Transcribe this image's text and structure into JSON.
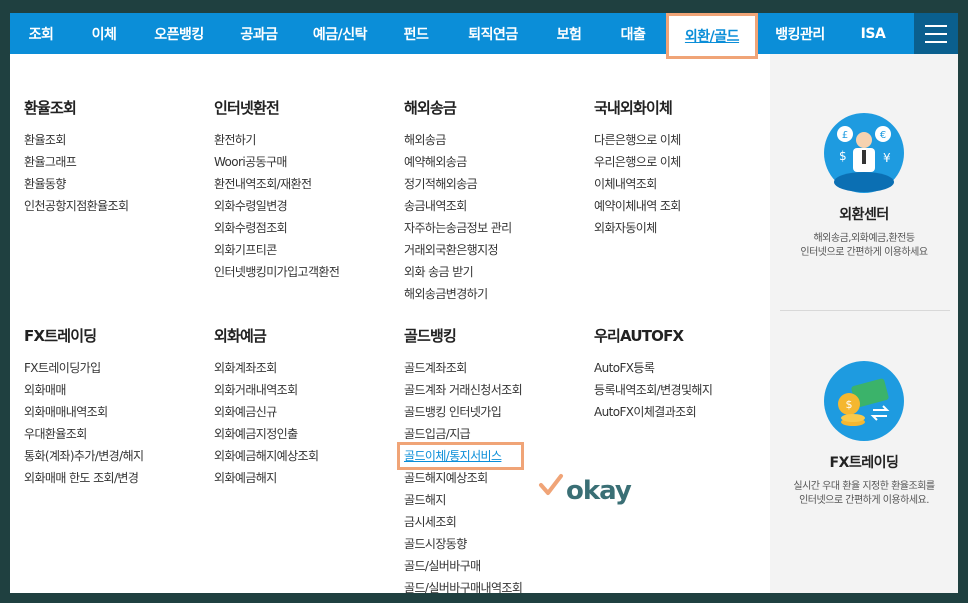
{
  "nav": {
    "items": [
      "조회",
      "이체",
      "오픈뱅킹",
      "공과금",
      "예금/신탁",
      "펀드",
      "퇴직연금",
      "보험",
      "대출",
      "외환/골드",
      "뱅킹관리",
      "ISA"
    ],
    "active": "외환/골드"
  },
  "columns": [
    {
      "sections": [
        {
          "title": "환율조회",
          "links": [
            "환율조회",
            "환율그래프",
            "환율동향",
            "인천공항지점환율조회"
          ]
        },
        {
          "title": "FX트레이딩",
          "links": [
            "FX트레이딩가입",
            "외화매매",
            "외화매매내역조회",
            "우대환율조회",
            "통화(계좌)추가/변경/해지",
            "외화매매 한도 조회/변경"
          ]
        }
      ]
    },
    {
      "sections": [
        {
          "title": "인터넷환전",
          "links": [
            "환전하기",
            "Woori공동구매",
            "환전내역조회/재환전",
            "외화수령일변경",
            "외화수령점조회",
            "외화기프티콘",
            "인터넷뱅킹미가입고객환전"
          ]
        },
        {
          "title": "외화예금",
          "links": [
            "외화계좌조회",
            "외화거래내역조회",
            "외화예금신규",
            "외화예금지정인출",
            "외화예금해지예상조회",
            "외화예금해지"
          ]
        }
      ]
    },
    {
      "sections": [
        {
          "title": "해외송금",
          "links": [
            "해외송금",
            "예약해외송금",
            "정기적해외송금",
            "송금내역조회",
            "자주하는송금정보 관리",
            "거래외국환은행지정",
            "외화 송금 받기",
            "해외송금변경하기"
          ]
        },
        {
          "title": "골드뱅킹",
          "links": [
            "골드계좌조회",
            "골드계좌 거래신청서조회",
            "골드뱅킹 인터넷가입",
            "골드입금/지급",
            "골드이체/통지서비스",
            "골드해지예상조회",
            "골드해지",
            "금시세조회",
            "골드시장동향",
            "골드/실버바구매",
            "골드/실버바구매내역조회"
          ]
        }
      ]
    },
    {
      "sections": [
        {
          "title": "국내외화이체",
          "links": [
            "다른은행으로 이체",
            "우리은행으로 이체",
            "이체내역조회",
            "예약이체내역 조회",
            "외화자동이체"
          ]
        },
        {
          "title": "우리AUTOFX",
          "links": [
            "AutoFX등록",
            "등록내역조회/변경및해지",
            "AutoFX이체결과조회"
          ]
        }
      ]
    }
  ],
  "highlighted_link": "골드이체/통지서비스",
  "annotation": "okay",
  "side": {
    "center": {
      "title": "외환센터",
      "desc1": "해외송금,외화예금,환전등",
      "desc2": "인터넷으로 간편하게 이용하세요"
    },
    "fx": {
      "title": "FX트레이딩",
      "desc1": "실시간 우대 환율 지정한 환율조회를",
      "desc2": "인터넷으로 간편하게 이용하세요."
    }
  },
  "colors": {
    "nav_bg": "#0b8ed8",
    "highlight_border": "#f0a477",
    "annotation": "#3a6f75"
  }
}
